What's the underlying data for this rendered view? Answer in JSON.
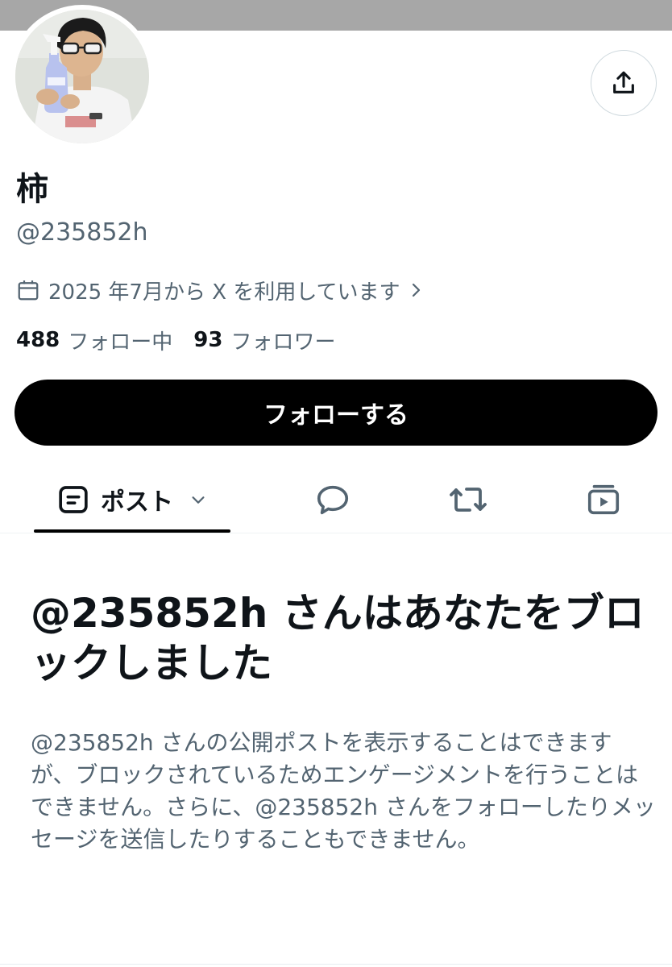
{
  "profile": {
    "display_name": "柿",
    "handle": "@235852h",
    "joined": "2025 年7月から X を利用しています",
    "following_count": "488",
    "following_label": "フォロー中",
    "followers_count": "93",
    "followers_label": "フォロワー"
  },
  "actions": {
    "follow_label": "フォローする"
  },
  "tabs": [
    {
      "label": "ポスト",
      "icon": "posts-icon"
    },
    {
      "icon": "reply-bubble-icon"
    },
    {
      "icon": "repost-icon"
    },
    {
      "icon": "media-icon"
    }
  ],
  "blocked": {
    "title": "@235852h さんはあなたをブロックしました",
    "description": "@235852h さんの公開ポストを表示することはできますが、ブロックされているためエンゲージメントを行うことはできません。さらに、@235852h さんをフォローしたりメッセージを送信したりすることもできません。"
  },
  "colors": {
    "primary_text": "#0f1419",
    "secondary_text": "#536471",
    "follow_button_bg": "#000000",
    "banner": "#a7a7a7"
  }
}
